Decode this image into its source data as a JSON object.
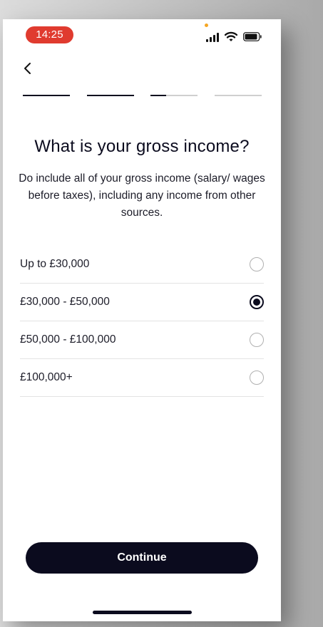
{
  "status_bar": {
    "time": "14:25",
    "time_pill_color": "#e03b2f",
    "icons": [
      "cellular-signal-icon",
      "wifi-icon",
      "battery-icon"
    ]
  },
  "nav": {
    "back_icon": "chevron-left-icon"
  },
  "progress_steps": [
    {
      "state": "complete",
      "fill": 1.0
    },
    {
      "state": "complete",
      "fill": 1.0
    },
    {
      "state": "current",
      "fill": 0.33
    },
    {
      "state": "upcoming",
      "fill": 0.0
    }
  ],
  "page": {
    "title": "What is your gross income?",
    "subtitle": "Do include all of your gross income (salary/ wages before taxes), including any income from other sources."
  },
  "options": [
    {
      "label": "Up to £30,000",
      "selected": false
    },
    {
      "label": "£30,000 - £50,000",
      "selected": true
    },
    {
      "label": "£50,000 - £100,000",
      "selected": false
    },
    {
      "label": "£100,000+",
      "selected": false
    }
  ],
  "footer": {
    "continue_label": "Continue"
  },
  "colors": {
    "primary": "#0b0b1e",
    "divider": "#e3e3e3",
    "progress_track": "#cfcfcf"
  }
}
